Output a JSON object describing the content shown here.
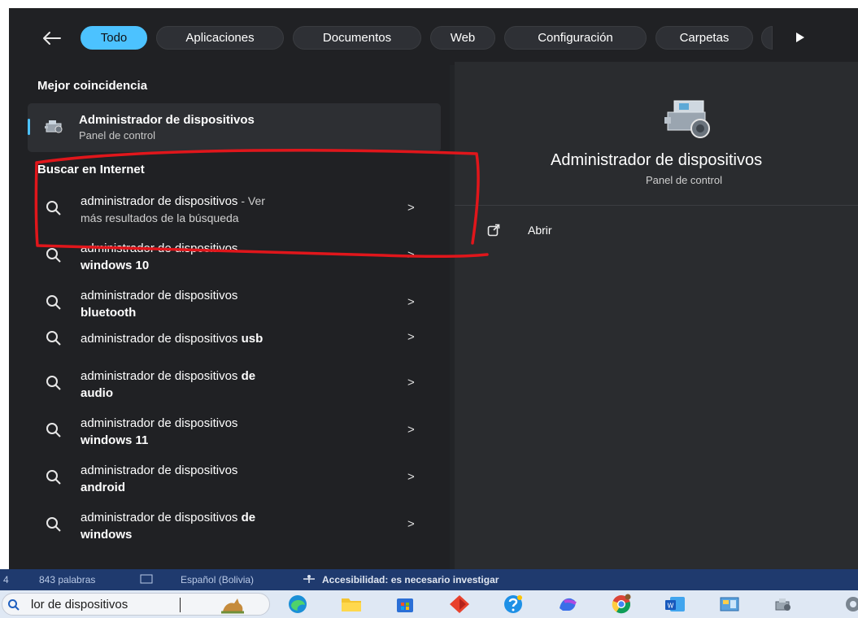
{
  "filters": {
    "back_label": "←",
    "tabs": [
      {
        "label": "Todo",
        "active": true
      },
      {
        "label": "Aplicaciones",
        "active": false
      },
      {
        "label": "Documentos",
        "active": false
      },
      {
        "label": "Web",
        "active": false
      },
      {
        "label": "Configuración",
        "active": false
      },
      {
        "label": "Carpetas",
        "active": false
      }
    ]
  },
  "best_match": {
    "heading": "Mejor coincidencia",
    "title": "Administrador de dispositivos",
    "subtitle": "Panel de control"
  },
  "web_search": {
    "heading": "Buscar en Internet",
    "results": [
      {
        "plain": "administrador de dispositivos",
        "rest": " - Ver",
        "line2": "más resultados de la búsqueda",
        "line2_bold": false
      },
      {
        "plain": "administrador de dispositivos",
        "rest": "",
        "line2": "windows 10",
        "line2_bold": true
      },
      {
        "plain": "administrador de dispositivos",
        "rest": "",
        "line2": "bluetooth",
        "line2_bold": true
      },
      {
        "plain": "administrador de dispositivos",
        "rest_bold": " usb",
        "line2": "",
        "line2_bold": true
      },
      {
        "plain": "administrador de dispositivos",
        "rest_bold": " de",
        "line2": "audio",
        "line2_bold": true
      },
      {
        "plain": "administrador de dispositivos",
        "rest": "",
        "line2": "windows 11",
        "line2_bold": true
      },
      {
        "plain": "administrador de dispositivos",
        "rest": "",
        "line2": "android",
        "line2_bold": true
      },
      {
        "plain": "administrador de dispositivos",
        "rest_bold": " de",
        "line2": "windows",
        "line2_bold": true
      }
    ],
    "chevron": ">"
  },
  "detail": {
    "title": "Administrador de dispositivos",
    "subtitle": "Panel de control",
    "open_label": "Abrir"
  },
  "status_bar": {
    "page_num": "4",
    "words": "843 palabras",
    "language": "Español (Bolivia)",
    "accessibility": "Accesibilidad: es necesario investigar"
  },
  "taskbar": {
    "search_text": "lor de dispositivos",
    "apps": [
      "edge-icon",
      "file-explorer-icon",
      "store-icon",
      "office-icon",
      "help-icon",
      "copilot-icon",
      "chrome-icon",
      "word-icon",
      "control-panel-icon",
      "device-manager-icon",
      "settings-icon"
    ]
  },
  "colors": {
    "accent": "#4cc2ff",
    "panel_bg": "#202124",
    "detail_bg": "#2a2c2f",
    "annotation_red": "#e0161b"
  }
}
